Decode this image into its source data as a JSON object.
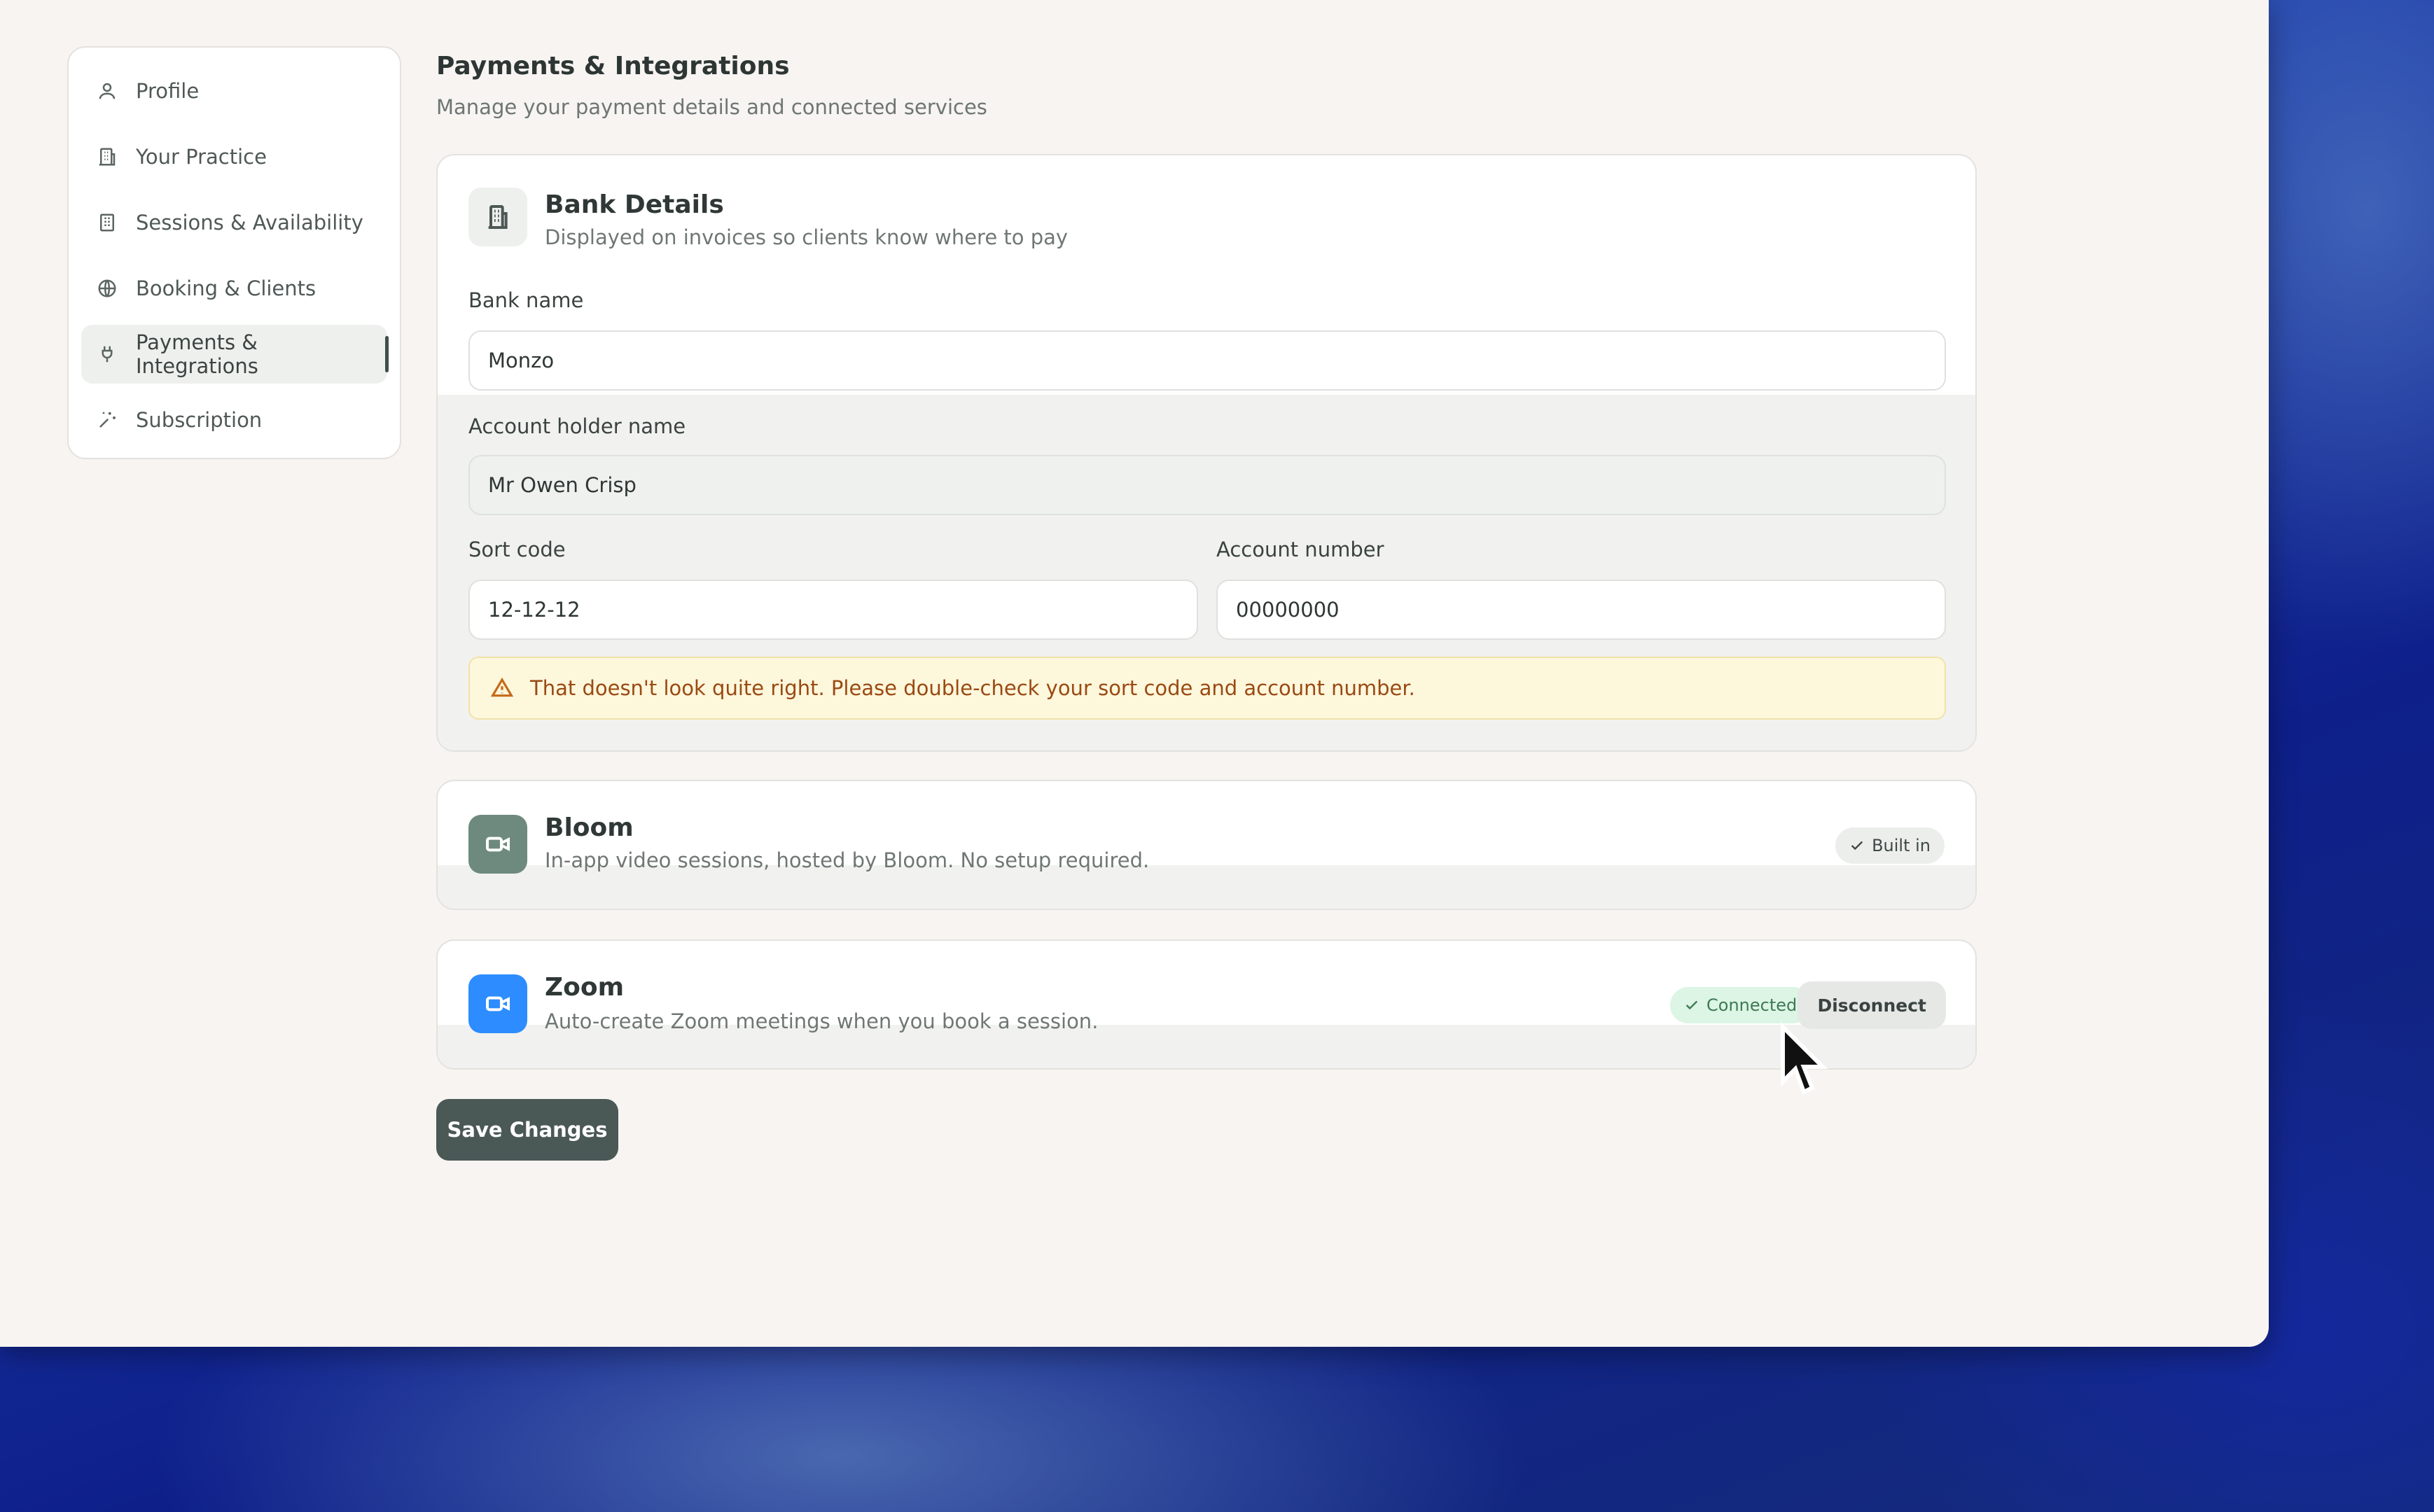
{
  "sidebar": {
    "items": [
      {
        "label": "Profile",
        "icon": "user-icon"
      },
      {
        "label": "Your Practice",
        "icon": "building-icon"
      },
      {
        "label": "Sessions & Availability",
        "icon": "calendar-building-icon"
      },
      {
        "label": "Booking & Clients",
        "icon": "globe-icon"
      },
      {
        "label": "Payments & Integrations",
        "icon": "plug-icon",
        "active": true
      },
      {
        "label": "Subscription",
        "icon": "sparkles-icon"
      }
    ]
  },
  "header": {
    "title": "Payments & Integrations",
    "subtitle": "Manage your payment details and connected services"
  },
  "bank": {
    "title": "Bank Details",
    "subtitle": "Displayed on invoices so clients know where to pay",
    "bank_name_label": "Bank name",
    "bank_name_value": "Monzo",
    "holder_label": "Account holder name",
    "holder_value": "Mr Owen Crisp",
    "sort_code_label": "Sort code",
    "sort_code_value": "12-12-12",
    "account_number_label": "Account number",
    "account_number_value": "00000000",
    "warning": "That doesn't look quite right. Please double-check your sort code and account number."
  },
  "bloom": {
    "title": "Bloom",
    "subtitle": "In-app video sessions, hosted by Bloom. No setup required.",
    "badge": "Built in"
  },
  "zoom": {
    "title": "Zoom",
    "subtitle": "Auto-create Zoom meetings when you book a session.",
    "status": "Connected",
    "disconnect_label": "Disconnect"
  },
  "save_label": "Save Changes",
  "colors": {
    "accent": "#4a5856",
    "zoom_blue": "#2d8cff",
    "bloom_green": "#6e8a7e",
    "warning_text": "#9a4a12",
    "connected_green": "#3f7a55"
  }
}
